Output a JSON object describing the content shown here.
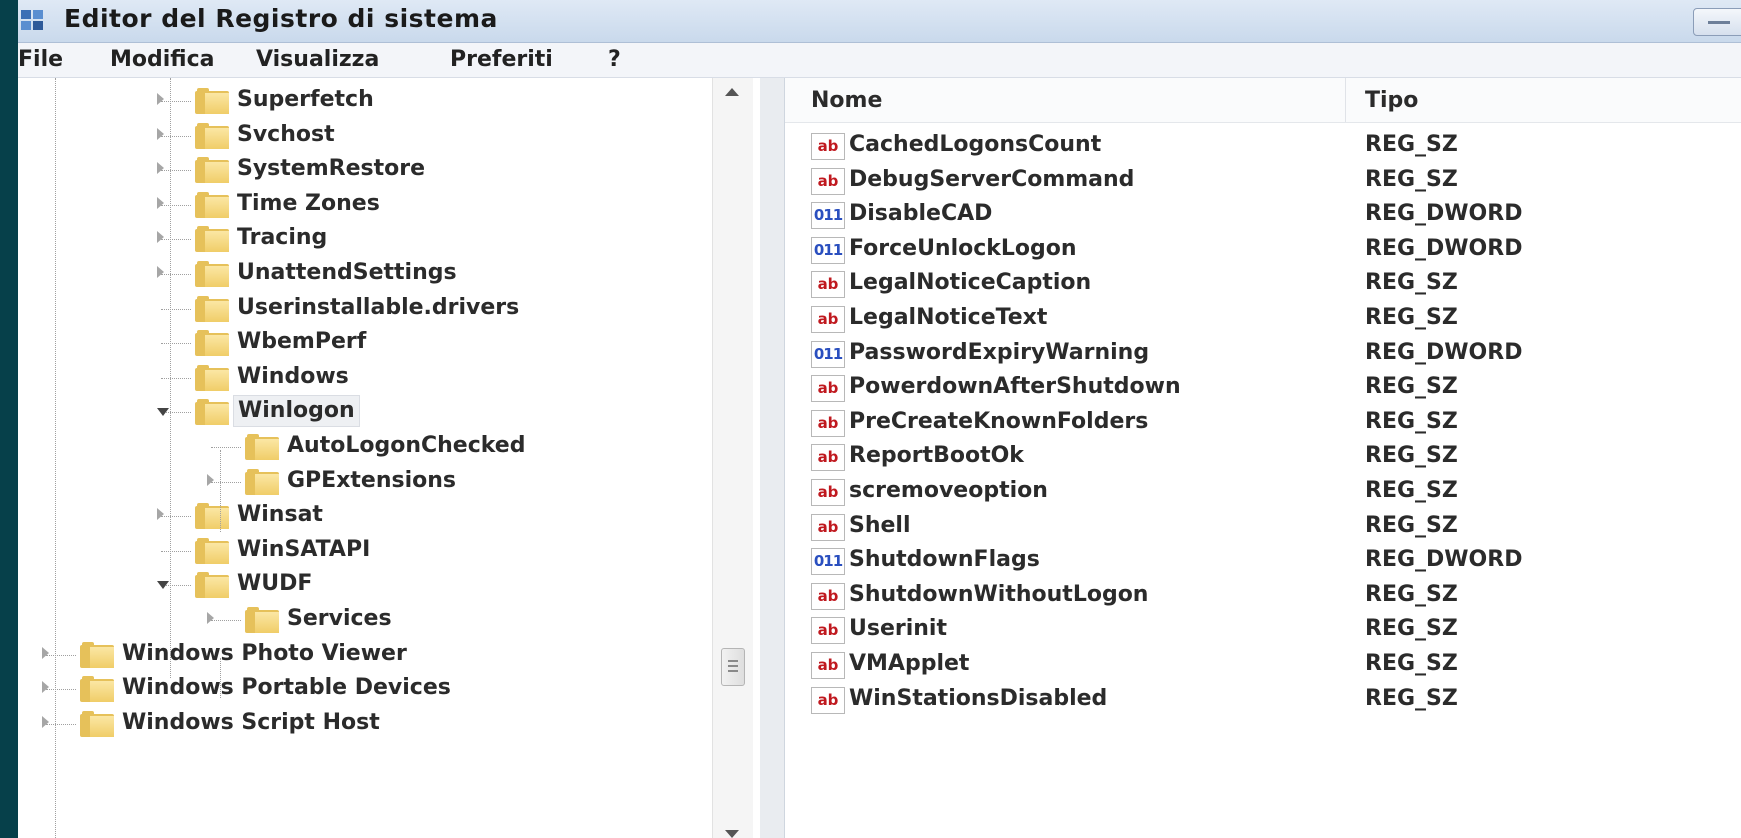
{
  "window": {
    "title": "Editor del Registro di sistema",
    "app_icon": "regedit-icon"
  },
  "menu": [
    "File",
    "Modifica",
    "Visualizza",
    "Preferiti",
    "?"
  ],
  "tree": {
    "nodes": [
      {
        "label": "Superfetch",
        "level": 2,
        "expander": "collapsed"
      },
      {
        "label": "Svchost",
        "level": 2,
        "expander": "collapsed"
      },
      {
        "label": "SystemRestore",
        "level": 2,
        "expander": "collapsed"
      },
      {
        "label": "Time Zones",
        "level": 2,
        "expander": "collapsed"
      },
      {
        "label": "Tracing",
        "level": 2,
        "expander": "collapsed"
      },
      {
        "label": "UnattendSettings",
        "level": 2,
        "expander": "collapsed"
      },
      {
        "label": "Userinstallable.drivers",
        "level": 2,
        "expander": "none"
      },
      {
        "label": "WbemPerf",
        "level": 2,
        "expander": "none"
      },
      {
        "label": "Windows",
        "level": 2,
        "expander": "none"
      },
      {
        "label": "Winlogon",
        "level": 2,
        "expander": "expanded",
        "selected": true
      },
      {
        "label": "AutoLogonChecked",
        "level": 3,
        "expander": "none"
      },
      {
        "label": "GPExtensions",
        "level": 3,
        "expander": "collapsed"
      },
      {
        "label": "Winsat",
        "level": 2,
        "expander": "collapsed"
      },
      {
        "label": "WinSATAPI",
        "level": 2,
        "expander": "none"
      },
      {
        "label": "WUDF",
        "level": 2,
        "expander": "expanded"
      },
      {
        "label": "Services",
        "level": 3,
        "expander": "collapsed"
      },
      {
        "label": "Windows Photo Viewer",
        "level": 1,
        "expander": "collapsed"
      },
      {
        "label": "Windows Portable Devices",
        "level": 1,
        "expander": "collapsed"
      },
      {
        "label": "Windows Script Host",
        "level": 1,
        "expander": "collapsed"
      }
    ]
  },
  "list": {
    "columns": {
      "name": "Nome",
      "type": "Tipo"
    },
    "rows": [
      {
        "name": "CachedLogonsCount",
        "type": "REG_SZ",
        "icon": "string-value-icon",
        "icon_text": "ab"
      },
      {
        "name": "DebugServerCommand",
        "type": "REG_SZ",
        "icon": "string-value-icon",
        "icon_text": "ab"
      },
      {
        "name": "DisableCAD",
        "type": "REG_DWORD",
        "icon": "binary-value-icon",
        "icon_text": "011"
      },
      {
        "name": "ForceUnlockLogon",
        "type": "REG_DWORD",
        "icon": "binary-value-icon",
        "icon_text": "011"
      },
      {
        "name": "LegalNoticeCaption",
        "type": "REG_SZ",
        "icon": "string-value-icon",
        "icon_text": "ab"
      },
      {
        "name": "LegalNoticeText",
        "type": "REG_SZ",
        "icon": "string-value-icon",
        "icon_text": "ab"
      },
      {
        "name": "PasswordExpiryWarning",
        "type": "REG_DWORD",
        "icon": "binary-value-icon",
        "icon_text": "011"
      },
      {
        "name": "PowerdownAfterShutdown",
        "type": "REG_SZ",
        "icon": "string-value-icon",
        "icon_text": "ab"
      },
      {
        "name": "PreCreateKnownFolders",
        "type": "REG_SZ",
        "icon": "string-value-icon",
        "icon_text": "ab"
      },
      {
        "name": "ReportBootOk",
        "type": "REG_SZ",
        "icon": "string-value-icon",
        "icon_text": "ab"
      },
      {
        "name": "scremoveoption",
        "type": "REG_SZ",
        "icon": "string-value-icon",
        "icon_text": "ab"
      },
      {
        "name": "Shell",
        "type": "REG_SZ",
        "icon": "string-value-icon",
        "icon_text": "ab"
      },
      {
        "name": "ShutdownFlags",
        "type": "REG_DWORD",
        "icon": "binary-value-icon",
        "icon_text": "011"
      },
      {
        "name": "ShutdownWithoutLogon",
        "type": "REG_SZ",
        "icon": "string-value-icon",
        "icon_text": "ab"
      },
      {
        "name": "Userinit",
        "type": "REG_SZ",
        "icon": "string-value-icon",
        "icon_text": "ab"
      },
      {
        "name": "VMApplet",
        "type": "REG_SZ",
        "icon": "string-value-icon",
        "icon_text": "ab"
      },
      {
        "name": "WinStationsDisabled",
        "type": "REG_SZ",
        "icon": "string-value-icon",
        "icon_text": "ab"
      }
    ]
  }
}
